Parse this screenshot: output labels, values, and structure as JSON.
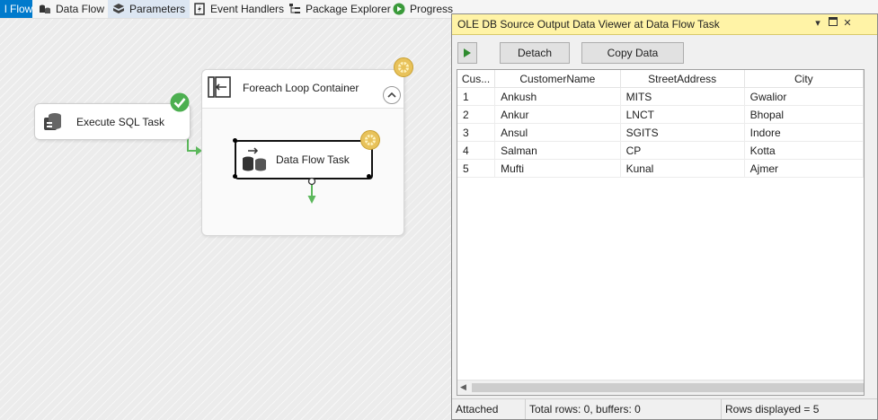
{
  "tabs": [
    {
      "label": "l Flow",
      "icon": "control-flow-icon",
      "state": "active"
    },
    {
      "label": "Data Flow",
      "icon": "data-flow-icon",
      "state": "normal"
    },
    {
      "label": "Parameters",
      "icon": "parameters-icon",
      "state": "selected"
    },
    {
      "label": "Event Handlers",
      "icon": "event-handlers-icon",
      "state": "normal"
    },
    {
      "label": "Package Explorer",
      "icon": "package-explorer-icon",
      "state": "normal"
    },
    {
      "label": "Progress",
      "icon": "progress-icon",
      "state": "normal"
    }
  ],
  "canvas": {
    "execute_sql_task": {
      "label": "Execute SQL Task",
      "status": "success"
    },
    "foreach_container": {
      "label": "Foreach Loop Container",
      "status": "running"
    },
    "data_flow_task": {
      "label": "Data Flow Task",
      "status": "running"
    }
  },
  "viewer": {
    "title": "OLE DB Source Output Data Viewer at Data Flow Task",
    "detach_label": "Detach",
    "copy_label": "Copy Data",
    "columns": [
      "Cus...",
      "CustomerName",
      "StreetAddress",
      "City"
    ],
    "rows": [
      [
        "1",
        "Ankush",
        "MITS",
        "Gwalior"
      ],
      [
        "2",
        "Ankur",
        "LNCT",
        "Bhopal"
      ],
      [
        "3",
        "Ansul",
        "SGITS",
        "Indore"
      ],
      [
        "4",
        "Salman",
        "CP",
        "Kotta"
      ],
      [
        "5",
        "Mufti",
        "Kunal",
        "Ajmer"
      ]
    ],
    "status": {
      "attached": "Attached",
      "total": "Total rows: 0, buffers: 0",
      "displayed": "Rows displayed = 5"
    }
  },
  "colors": {
    "accent": "#007acc",
    "viewer_title": "#fff3a6",
    "success": "#4caf50",
    "running": "#f0c419",
    "connector": "#5cb85c"
  }
}
